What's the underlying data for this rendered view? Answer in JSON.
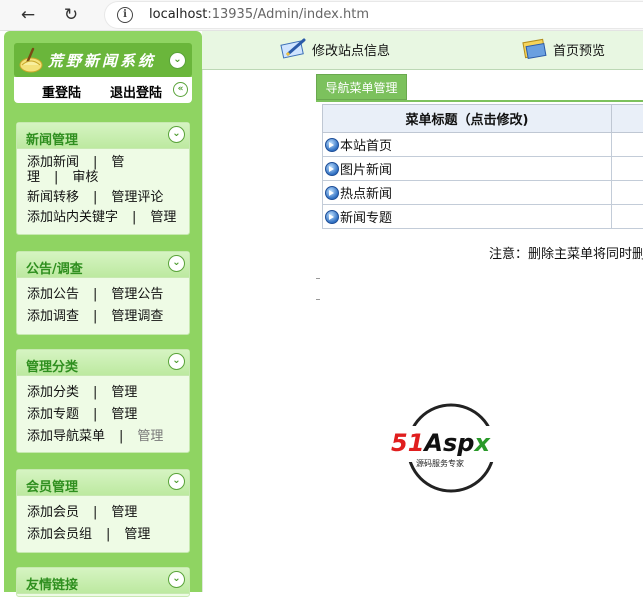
{
  "browser": {
    "url_host": "localhost",
    "url_rest": ":13935/Admin/index.htm"
  },
  "sidebar": {
    "brand_title": "荒野新闻系统",
    "relogin": "重登陆",
    "logout": "退出登陆",
    "news": {
      "title": "新闻管理",
      "add_news": "添加新闻",
      "manage": "管",
      "manage_cont": "理",
      "review": "审核",
      "news_transfer": "新闻转移",
      "manage_comments": "管理评论",
      "add_keywords": "添加站内关键字",
      "manage_kw": "管理"
    },
    "notice": {
      "title": "公告/调查",
      "add_notice": "添加公告",
      "manage_notice": "管理公告",
      "add_survey": "添加调查",
      "manage_survey": "管理调查"
    },
    "category": {
      "title": "管理分类",
      "add_category": "添加分类",
      "manage_category": "管理",
      "add_topic": "添加专题",
      "manage_topic": "管理",
      "add_nav_menu": "添加导航菜单",
      "manage_nav": "管理"
    },
    "member": {
      "title": "会员管理",
      "add_member": "添加会员",
      "manage_member": "管理",
      "add_group": "添加会员组",
      "manage_group": "管理"
    },
    "links": {
      "title": "友情链接"
    },
    "separator": "|"
  },
  "toolbar": {
    "edit_site_info": "修改站点信息",
    "homepage_preview": "首页预览"
  },
  "main": {
    "tab_label": "导航菜单管理",
    "table_header": "菜单标题（点击修改)",
    "rows": [
      "本站首页",
      "图片新闻",
      "热点新闻",
      "新闻专题"
    ],
    "note": "注意：删除主菜单将同时删"
  },
  "watermark": {
    "brand": "51Aspx",
    "slogan": "源码服务专家"
  },
  "colors": {
    "sidebar_green": "#8fd462",
    "tab_green": "#7cc15d",
    "panel_title": "#2f8f1f"
  }
}
